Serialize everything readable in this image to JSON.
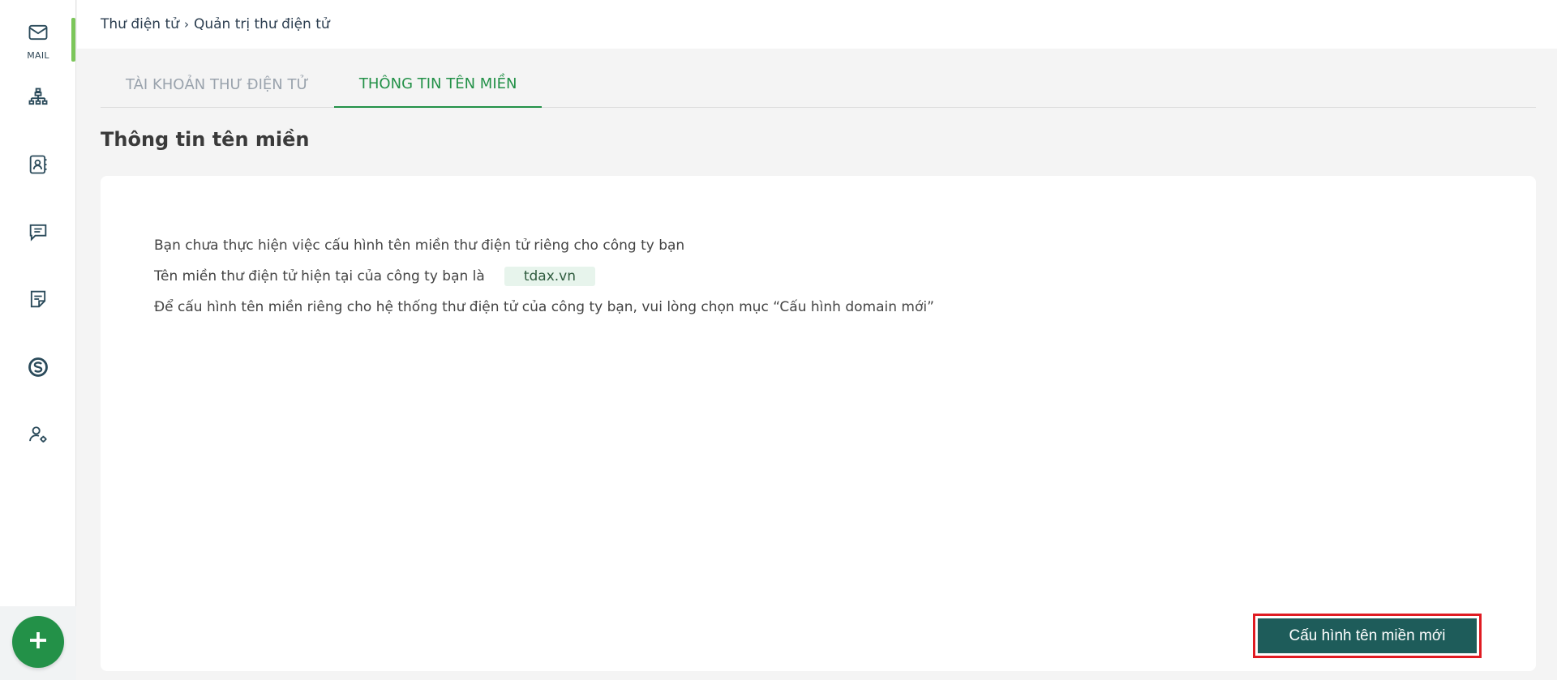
{
  "rail": {
    "items": [
      {
        "icon": "mail-icon",
        "label": "MAIL"
      },
      {
        "icon": "org-chart-icon",
        "label": ""
      },
      {
        "icon": "contacts-icon",
        "label": ""
      },
      {
        "icon": "chat-icon",
        "label": ""
      },
      {
        "icon": "notes-icon",
        "label": ""
      },
      {
        "icon": "brand-s-icon",
        "label": ""
      },
      {
        "icon": "user-settings-icon",
        "label": ""
      }
    ],
    "fab_icon": "plus-icon"
  },
  "breadcrumb": {
    "root": "Thư điện tử",
    "separator": "›",
    "current": "Quản trị thư điện tử"
  },
  "tabs": [
    {
      "label": "TÀI KHOẢN THƯ ĐIỆN TỬ",
      "active": false
    },
    {
      "label": "THÔNG TIN TÊN MIỀN",
      "active": true
    }
  ],
  "section": {
    "title": "Thông tin tên miền"
  },
  "info": {
    "line1": "Bạn chưa thực hiện việc cấu hình tên miền thư điện tử riêng cho công ty bạn",
    "line2": "Tên miền thư điện tử hiện tại của công ty bạn là",
    "domain": "tdax.vn",
    "line3": "Để cấu hình tên miền riêng cho hệ thống thư điện tử của công ty bạn, vui lòng chọn mục “Cấu hình domain mới”"
  },
  "actions": {
    "configure_label": "Cấu hình tên miền mới"
  },
  "colors": {
    "accent": "#239148",
    "primary_button": "#1e5c5a",
    "highlight_outline": "#e01b22"
  }
}
